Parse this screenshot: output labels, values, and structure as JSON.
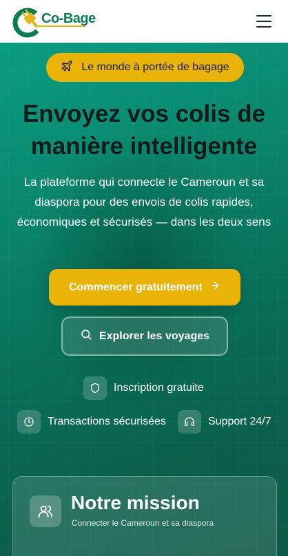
{
  "header": {
    "brand": "Co-Bage",
    "logo_icon": "cobage-plug-logo",
    "menu_icon": "hamburger-menu-icon"
  },
  "hero": {
    "badge": {
      "icon": "plane-icon",
      "label": "Le monde à portée de bagage"
    },
    "title_line1": "Envoyez vos colis de",
    "title_line2": "manière intelligente",
    "subtitle": "La plateforme qui connecte le Cameroun et sa diaspora pour des envois de colis rapides, économiques et sécurisés — dans les deux sens",
    "cta": {
      "label": "Commencer gratuitement",
      "icon": "arrow-right-icon"
    },
    "explore": {
      "label": "Explorer les voyages",
      "icon": "search-icon"
    },
    "features": [
      {
        "icon": "shield-icon",
        "label": "Inscription gratuite"
      },
      {
        "icon": "clock-icon",
        "label": "Transactions sécurisées"
      },
      {
        "icon": "headphones-icon",
        "label": "Support 24/7"
      }
    ]
  },
  "mission": {
    "icon": "users-icon",
    "title": "Notre mission",
    "subtitle": "Connecter le Cameroun et sa diaspora"
  },
  "colors": {
    "accent_yellow": "#eab308",
    "brand_green": "#0b7a55",
    "hero_teal": "#0a8a6f"
  }
}
